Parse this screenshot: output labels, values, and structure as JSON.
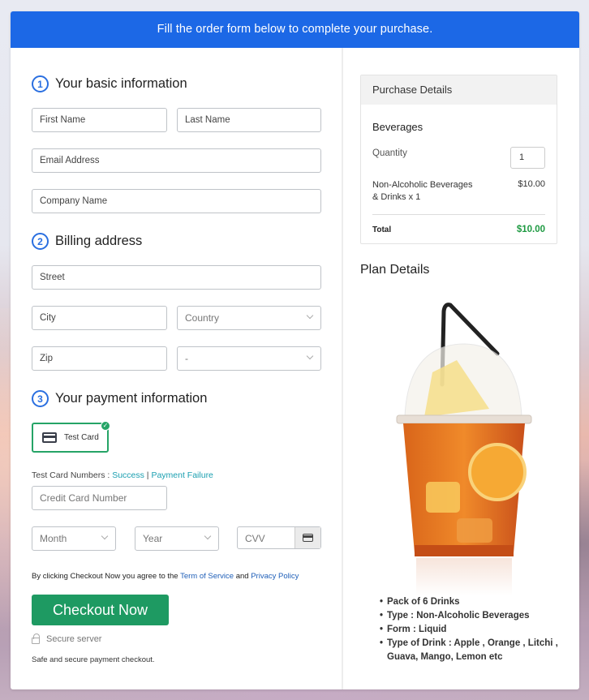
{
  "banner": {
    "text": "Fill the order form below to complete your purchase."
  },
  "sections": {
    "basic": {
      "number": "1",
      "title": "Your basic information"
    },
    "billing": {
      "number": "2",
      "title": "Billing address"
    },
    "payment": {
      "number": "3",
      "title": "Your payment information"
    }
  },
  "fields": {
    "first_name": {
      "placeholder": "First Name",
      "value": ""
    },
    "last_name": {
      "placeholder": "Last Name",
      "value": ""
    },
    "email": {
      "placeholder": "Email Address",
      "value": ""
    },
    "company": {
      "placeholder": "Company Name",
      "value": ""
    },
    "street": {
      "placeholder": "Street",
      "value": ""
    },
    "city": {
      "placeholder": "City",
      "value": ""
    },
    "country": {
      "selected": "Country"
    },
    "zip": {
      "placeholder": "Zip",
      "value": ""
    },
    "state": {
      "selected": "-"
    },
    "card_number": {
      "placeholder": "Credit Card Number",
      "value": ""
    },
    "month": {
      "selected": "Month"
    },
    "year": {
      "selected": "Year"
    },
    "cvv": {
      "placeholder": "CVV",
      "value": ""
    }
  },
  "payment": {
    "method_label": "Test Card",
    "method_icon": "credit-card-icon",
    "selected_icon": "check-circle-icon",
    "test_numbers_label": "Test Card Numbers : ",
    "success_link": "Success",
    "separator": " | ",
    "failure_link": "Payment Failure"
  },
  "terms": {
    "prefix": "By clicking Checkout Now you agree to the ",
    "tos_link": "Term of Service",
    "and": " and ",
    "privacy_link": "Privacy Policy"
  },
  "checkout": {
    "button_label": "Checkout Now",
    "secure_label": "Secure server",
    "safe_note": "Safe and secure payment checkout."
  },
  "purchase": {
    "header": "Purchase Details",
    "product": "Beverages",
    "quantity_label": "Quantity",
    "quantity": "1",
    "item_line1": "Non-Alcoholic Beverages",
    "item_line2": "& Drinks x 1",
    "item_price": "$10.00",
    "total_label": "Total",
    "total_value": "$10.00",
    "total_color": "#1e9a42"
  },
  "plan": {
    "title": "Plan Details",
    "image_alt": "iced tea drink in plastic cup with straw",
    "features": [
      "Pack of 6 Drinks",
      "Type : Non-Alcoholic Beverages",
      "Form : Liquid",
      "Type of Drink : Apple , Orange , Litchi , Guava, Mango, Lemon etc"
    ]
  },
  "colors": {
    "banner": "#1c68e6",
    "checkout": "#1e9a62",
    "step": "#2a6fe0",
    "selected_border": "#25a466"
  }
}
